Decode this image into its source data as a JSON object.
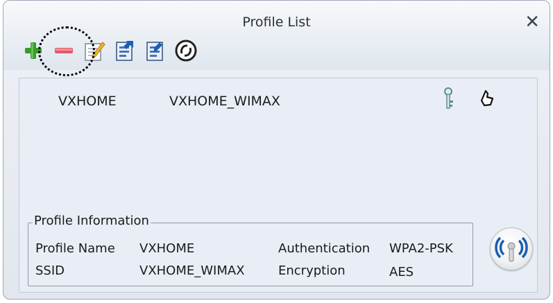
{
  "window": {
    "title": "Profile List"
  },
  "toolbar": {
    "buttons": [
      {
        "icon": "add-icon"
      },
      {
        "icon": "remove-icon"
      },
      {
        "icon": "edit-icon"
      },
      {
        "icon": "import-icon"
      },
      {
        "icon": "export-icon"
      },
      {
        "icon": "connect-icon"
      }
    ]
  },
  "profiles": [
    {
      "name": "VXHOME",
      "ssid": "VXHOME_WIMAX"
    }
  ],
  "info": {
    "legend": "Profile Information",
    "profile_name_label": "Profile Name",
    "profile_name_value": "VXHOME",
    "ssid_label": "SSID",
    "ssid_value": "VXHOME_WIMAX",
    "authentication_label": "Authentication",
    "authentication_value": "WPA2-PSK",
    "encryption_label": "Encryption",
    "encryption_value": "AES"
  },
  "colors": {
    "accent_blue": "#1a5fb4",
    "add_green": "#3a9a2a",
    "remove_red": "#e05a6a"
  }
}
